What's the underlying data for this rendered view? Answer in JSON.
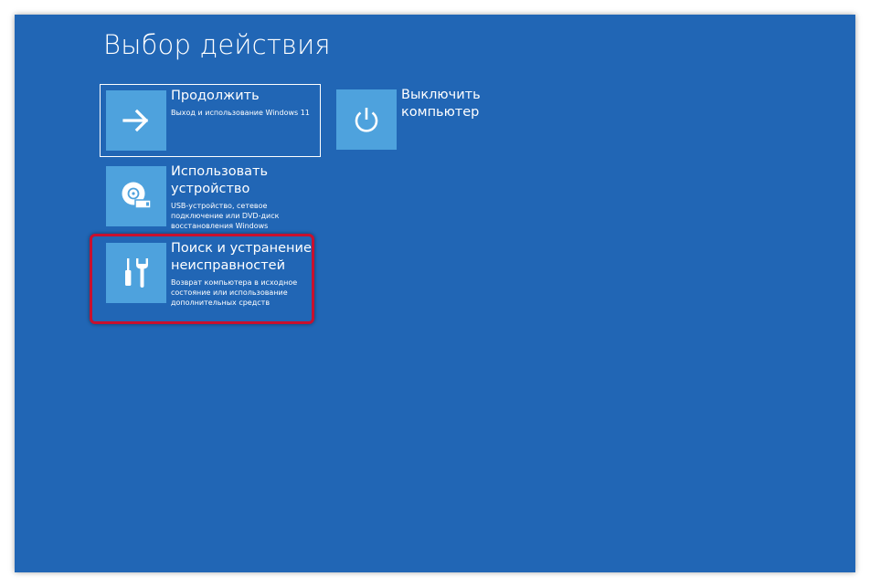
{
  "title": "Выбор действия",
  "options": [
    {
      "id": "continue",
      "title": "Продолжить",
      "description": "Выход и использование Windows 11",
      "icon": "arrow-right-icon"
    },
    {
      "id": "shutdown",
      "title": "Выключить компьютер",
      "description": "",
      "icon": "power-icon"
    },
    {
      "id": "use-device",
      "title": "Использовать устройство",
      "description": "USB-устройство, сетевое подключение или DVD-диск восстановления Windows",
      "icon": "disc-drive-icon"
    },
    {
      "id": "troubleshoot",
      "title": "Поиск и устранение неисправностей",
      "description": "Возврат компьютера в исходное состояние или использование дополнительных средств",
      "icon": "tools-icon"
    }
  ],
  "colors": {
    "background": "#2166b5",
    "tile": "#4ea2dd",
    "highlight": "#c8102e"
  }
}
